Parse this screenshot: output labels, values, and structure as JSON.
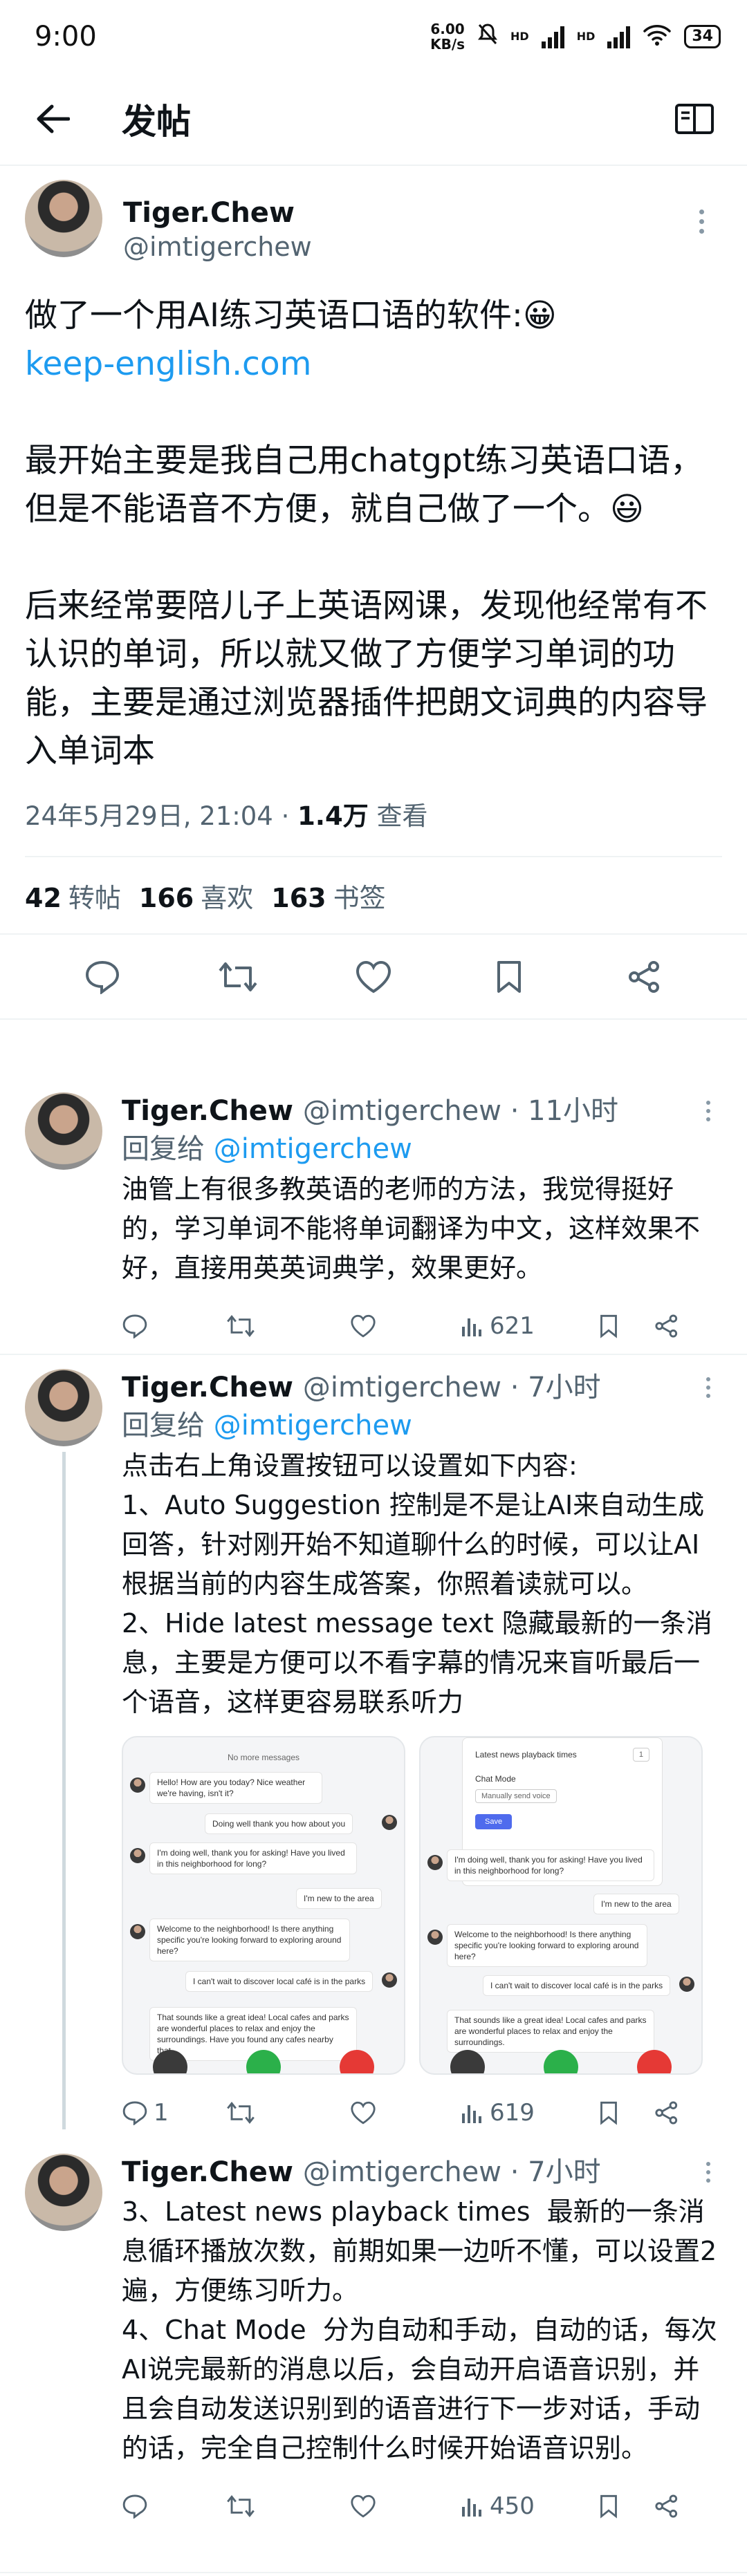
{
  "status_bar": {
    "time": "9:00",
    "net_speed_value": "6.00",
    "net_speed_unit": "KB/s",
    "network": "HD",
    "battery": "34"
  },
  "top_bar": {
    "title": "发帖"
  },
  "main_post": {
    "author_name": "Tiger.Chew",
    "author_handle": "@imtigerchew",
    "text_1": "做了一个用AI练习英语口语的软件:😀",
    "link": "keep-english.com",
    "text_2": "最开始主要是我自己用chatgpt练习英语口语，但是不能语音不方便，就自己做了一个。😃",
    "text_3": "后来经常要陪儿子上英语网课，发现他经常有不认识的单词，所以就又做了方便学习单词的功能，主要是通过浏览器插件把朗文词典的内容导入单词本",
    "timestamp": "24年5月29日, 21:04",
    "views_count": "1.4万",
    "views_label": "查看",
    "reposts_count": "42",
    "reposts_label": "转帖",
    "likes_count": "166",
    "likes_label": "喜欢",
    "bookmarks_count": "163",
    "bookmarks_label": "书签"
  },
  "replies": [
    {
      "name": "Tiger.Chew",
      "handle_time": "@imtigerchew · 11小时",
      "reply_to_label": "回复给",
      "reply_to_handle": "@imtigerchew",
      "text": "油管上有很多教英语的老师的方法，我觉得挺好的，学习单词不能将单词翻译为中文，这样效果不好，直接用英英词典学，效果更好。",
      "reply_count": "",
      "views": "621"
    },
    {
      "name": "Tiger.Chew",
      "handle_time": "@imtigerchew · 7小时",
      "reply_to_label": "回复给",
      "reply_to_handle": "@imtigerchew",
      "text": "点击右上角设置按钮可以设置如下内容:\n1、Auto Suggestion 控制是不是让AI来自动生成回答，针对刚开始不知道聊什么的时候，可以让AI根据当前的内容生成答案，你照着读就可以。\n2、Hide latest message text 隐藏最新的一条消息，主要是方便可以不看字幕的情况来盲听最后一个语音，这样更容易联系听力",
      "reply_count": "1",
      "views": "619"
    },
    {
      "name": "Tiger.Chew",
      "handle_time": "@imtigerchew · 7小时",
      "text": "3、Latest news playback times  最新的一条消息循环播放次数，前期如果一边听不懂，可以设置2遍，方便练习听力。\n4、Chat Mode  分为自动和手动，自动的话，每次AI说完最新的消息以后，会自动开启语音识别，并且会自动发送识别到的语音进行下一步对话，手动的话，完全自己控制什么时候开始语音识别。",
      "reply_count": "",
      "views": "450"
    }
  ],
  "screenshot_left": {
    "top_note": "No more messages",
    "messages": [
      "Hello! How are you today? Nice weather we're having, isn't it?",
      "Doing well thank you how about you",
      "I'm doing well, thank you for asking! Have you lived in this neighborhood for long?",
      "I'm new to the area",
      "Welcome to the neighborhood! Is there anything specific you're looking forward to exploring around here?",
      "I can't wait to discover local café is in the parks",
      "That sounds like a great idea! Local cafes and parks are wonderful places to relax and enjoy the surroundings. Have you found any cafes nearby that"
    ]
  },
  "screenshot_right": {
    "playback_label": "Latest news playback times",
    "playback_value": "1",
    "chat_mode_label": "Chat Mode",
    "chat_mode_value": "Manually send voice",
    "save_label": "Save",
    "messages": [
      "I'm doing well, thank you for asking! Have you lived in this neighborhood for long?",
      "I'm new to the area",
      "Welcome to the neighborhood! Is there anything specific you're looking forward to exploring around here?",
      "I can't wait to discover local café is in the parks",
      "That sounds like a great idea! Local cafes and parks are wonderful places to relax and enjoy the surroundings."
    ]
  },
  "icons": [
    "back-arrow-icon",
    "reader-icon",
    "more-icon",
    "reply-icon",
    "repost-icon",
    "like-icon",
    "bookmark-icon",
    "share-icon",
    "views-icon"
  ],
  "colors": {
    "link": "#1d9bf0",
    "muted": "#536471",
    "text": "#0f1419"
  }
}
